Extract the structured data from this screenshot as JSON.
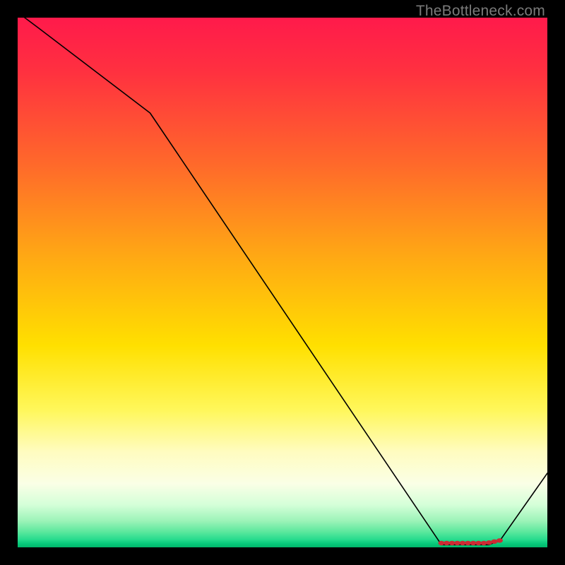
{
  "attribution": "TheBottleneck.com",
  "colors": {
    "background": "#000000",
    "attribution_text": "#7a7a7a",
    "curve": "#000000",
    "marker": "#cc2b34"
  },
  "chart_data": {
    "type": "line",
    "title": "",
    "xlabel": "",
    "ylabel": "",
    "xlim": [
      0,
      100
    ],
    "ylim": [
      0,
      100
    ],
    "x": [
      0,
      4,
      25,
      80,
      82,
      83,
      84,
      85,
      86,
      87,
      88,
      89,
      90,
      91,
      100
    ],
    "values": [
      101,
      98,
      82,
      0.5,
      0.5,
      0.5,
      0.5,
      0.5,
      0.5,
      0.5,
      0.5,
      0.5,
      0.9,
      1.2,
      14
    ],
    "markers": {
      "comment": "red dotted markers along the valley floor",
      "x": [
        80,
        81,
        82,
        83,
        84,
        85,
        86,
        87,
        88,
        89,
        90,
        91
      ],
      "y": [
        0.8,
        0.8,
        0.8,
        0.8,
        0.8,
        0.8,
        0.8,
        0.8,
        0.8,
        0.9,
        1.1,
        1.3
      ]
    }
  }
}
